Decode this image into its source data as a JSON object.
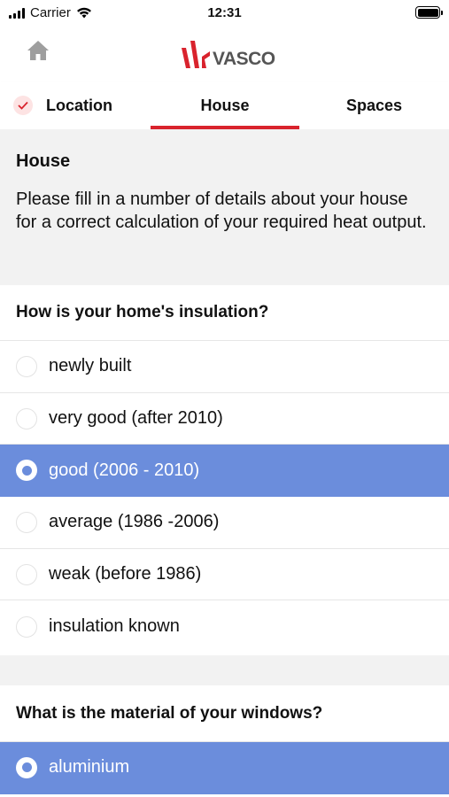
{
  "status_bar": {
    "carrier": "Carrier",
    "time": "12:31"
  },
  "header": {
    "brand": "VASCO",
    "brand_color": "#d9232d"
  },
  "tabs": [
    {
      "label": "Location",
      "completed": true
    },
    {
      "label": "House",
      "active": true
    },
    {
      "label": "Spaces"
    }
  ],
  "intro": {
    "title": "House",
    "text": "Please fill in a number of details about your house for a correct calculation of your required heat output."
  },
  "insulation": {
    "question": "How is your home's insulation?",
    "options": [
      {
        "label": "newly built",
        "selected": false
      },
      {
        "label": "very good (after 2010)",
        "selected": false
      },
      {
        "label": "good (2006 - 2010)",
        "selected": true
      },
      {
        "label": "average (1986 -2006)",
        "selected": false
      },
      {
        "label": "weak (before 1986)",
        "selected": false
      },
      {
        "label": "insulation known",
        "selected": false
      }
    ]
  },
  "windows": {
    "question": "What is the material of your windows?",
    "options": [
      {
        "label": "aluminium",
        "selected": true
      }
    ]
  },
  "colors": {
    "accent_red": "#d9232d",
    "selected_blue": "#6b8ddc",
    "section_gray": "#f2f2f2"
  }
}
